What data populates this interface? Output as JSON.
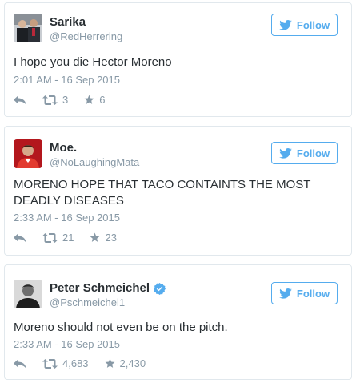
{
  "colors": {
    "accent": "#55acee",
    "border": "#e1e8ed",
    "muted": "#8899a6",
    "text": "#292f33",
    "verified": "#55acee"
  },
  "icons": {
    "follow": "twitter-bird-icon",
    "reply": "reply-icon",
    "retweet": "retweet-icon",
    "favorite": "star-icon",
    "verified": "verified-badge-icon"
  },
  "tweets": [
    {
      "name": "Sarika",
      "handle": "@RedHerrering",
      "verified": false,
      "follow_label": "Follow",
      "text": "I hope you die Hector Moreno",
      "timestamp": "2:01 AM - 16 Sep 2015",
      "retweets": "3",
      "favorites": "6"
    },
    {
      "name": "Moe.",
      "handle": "@NoLaughingMata",
      "verified": false,
      "follow_label": "Follow",
      "text": "MORENO HOPE THAT TACO CONTAINTS THE MOST DEADLY DISEASES",
      "timestamp": "2:33 AM - 16 Sep 2015",
      "retweets": "21",
      "favorites": "23"
    },
    {
      "name": "Peter Schmeichel",
      "handle": "@Pschmeichel1",
      "verified": true,
      "follow_label": "Follow",
      "text": "Moreno should not even be on the pitch.",
      "timestamp": "2:33 AM - 16 Sep 2015",
      "retweets": "4,683",
      "favorites": "2,430"
    }
  ]
}
